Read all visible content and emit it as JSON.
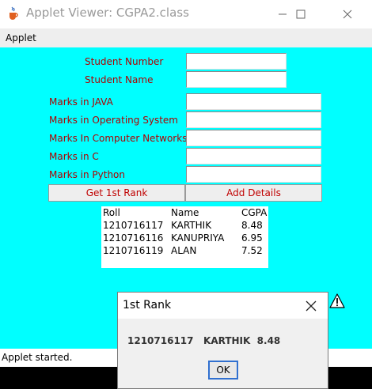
{
  "window": {
    "title": "Applet Viewer: CGPA2.class",
    "icons": [
      "java-cup-icon",
      "minimize-icon",
      "maximize-icon",
      "close-icon"
    ]
  },
  "menu": {
    "applet": "Applet"
  },
  "form": {
    "student_number_label": "Student Number",
    "student_name_label": "Student Name",
    "java_label": "Marks in JAVA",
    "os_label": "Marks in Operating System",
    "cn_label": "Marks In Computer Networks",
    "c_label": "Marks in C",
    "python_label": "Marks in Python",
    "student_number": "",
    "student_name": "",
    "java": "",
    "os": "",
    "cn": "",
    "c": "",
    "python": "",
    "get_rank_button": "Get 1st Rank",
    "add_details_button": "Add Details"
  },
  "results": {
    "headers": [
      "Roll",
      "Name",
      "CGPA"
    ],
    "rows": [
      [
        "1210716117",
        "KARTHIK",
        "8.48"
      ],
      [
        "1210716116",
        "KANUPRIYA",
        "6.95"
      ],
      [
        "1210716119",
        "ALAN",
        "7.52"
      ]
    ]
  },
  "status": {
    "text": "Applet started."
  },
  "dialog": {
    "title": "1st Rank",
    "message": "1210716117   KARTHIK  8.48",
    "ok": "OK",
    "icons": [
      "close-icon",
      "warning-icon"
    ]
  },
  "colors": {
    "applet_background": "#00ffff",
    "label_text": "#b00000",
    "button_text": "#c00000"
  }
}
